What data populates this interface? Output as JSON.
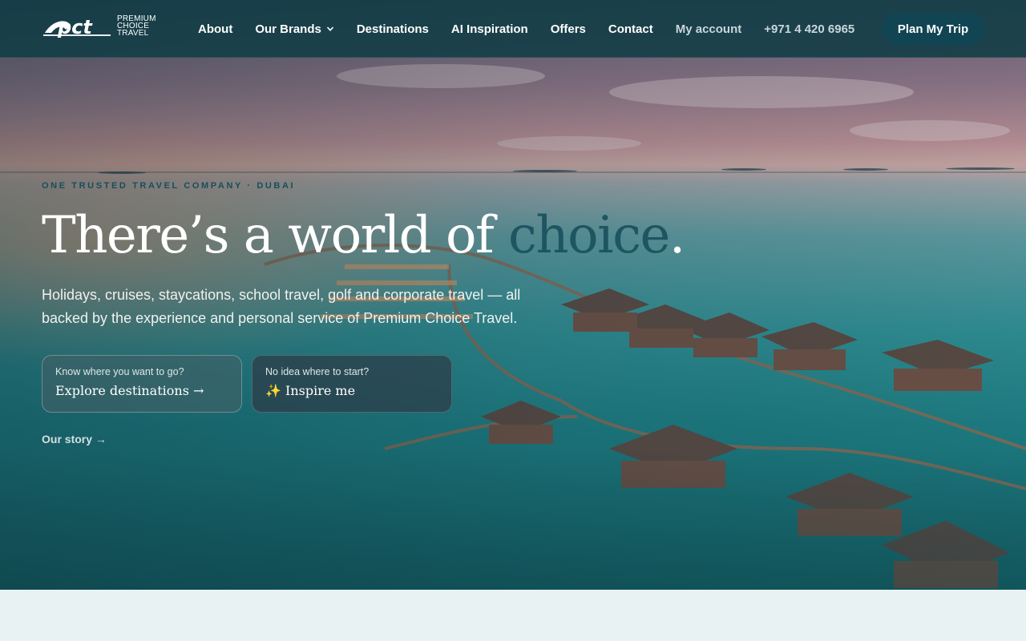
{
  "header": {
    "logo_mark": "pct",
    "logo_text_lines": [
      "PREMIUM",
      "CHOICE",
      "TRAVEL"
    ],
    "nav": [
      {
        "label": "About"
      },
      {
        "label": "Our Brands",
        "icon": "chevron-down-icon"
      },
      {
        "label": "Destinations"
      },
      {
        "label": "AI Inspiration"
      },
      {
        "label": "Offers"
      },
      {
        "label": "Contact"
      },
      {
        "label": "My account"
      },
      {
        "label": "+971 4 420 6965"
      }
    ],
    "cta_label": "Plan My Trip"
  },
  "hero": {
    "eyebrow": "ONE TRUSTED TRAVEL COMPANY · DUBAI",
    "headline_prefix": "There’s a world of ",
    "headline_accent": "choice",
    "headline_suffix": ".",
    "subtext": "Holidays, cruises, staycations, school travel, golf and corporate travel — all backed by the experience and personal service of Premium Choice Travel.",
    "cards": [
      {
        "hint": "Know where you want to go?",
        "title": "Explore destinations →"
      },
      {
        "hint": "No idea where to start?",
        "title": "✨ Inspire me"
      }
    ],
    "story_link": "Our story →"
  },
  "colors": {
    "header_bg": "#113c46",
    "cta_bg": "#114553",
    "accent_text": "#1d5561",
    "page_bg": "#e8f2f3"
  }
}
